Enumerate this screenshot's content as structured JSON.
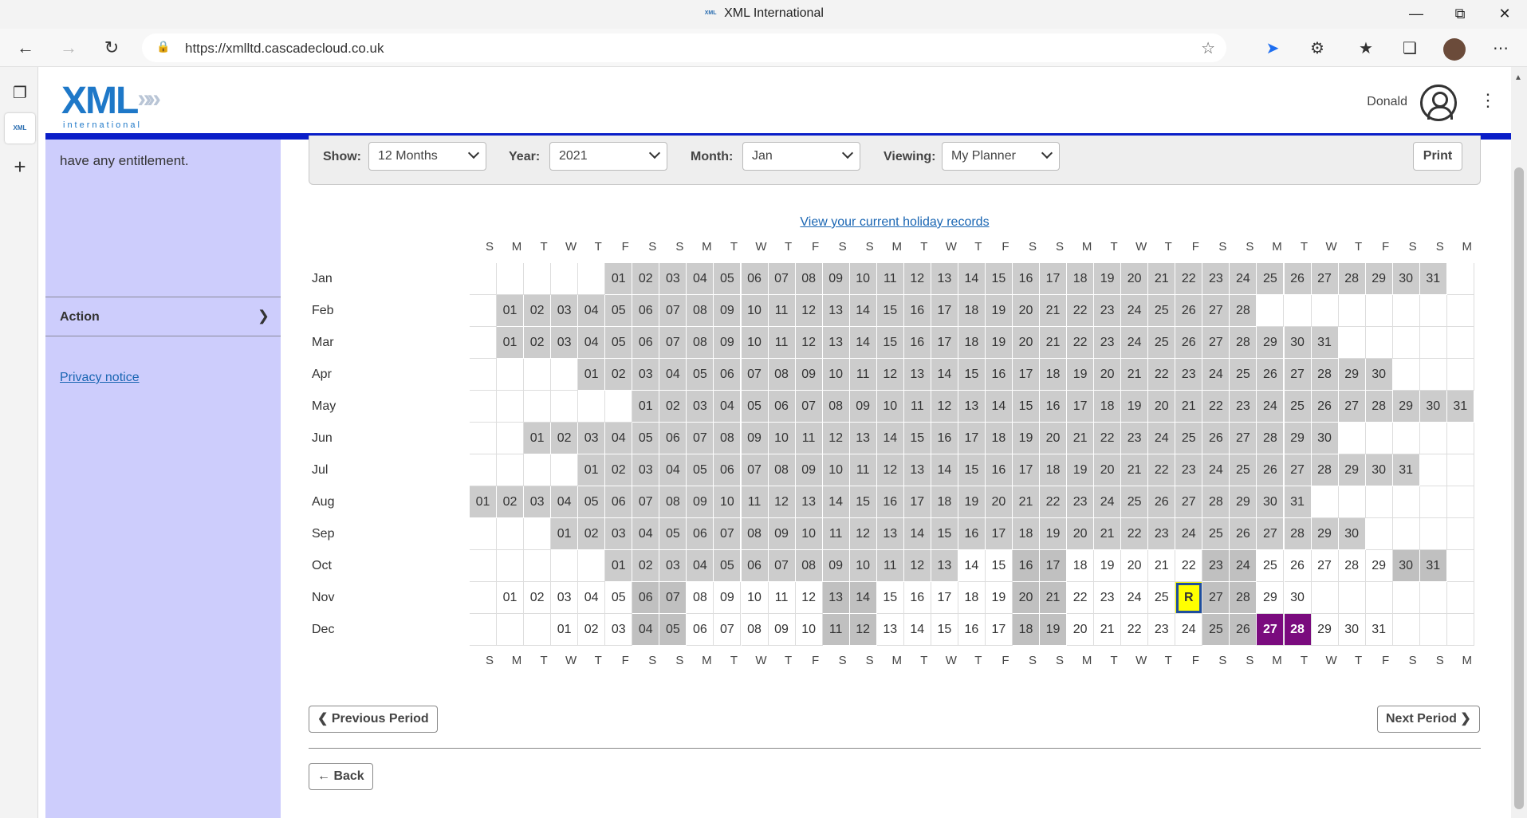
{
  "browser": {
    "title": "XML International",
    "url": "https://xmlltd.cascadecloud.co.uk",
    "favicon_text": "XML"
  },
  "header": {
    "logo_main": "XML",
    "logo_sub": "international",
    "username": "Donald"
  },
  "sidebar": {
    "entitlement_partial": "have any entitlement.",
    "action_label": "Action",
    "privacy_link": "Privacy notice"
  },
  "filters": {
    "show_label": "Show:",
    "show_value": "12 Months",
    "year_label": "Year:",
    "year_value": "2021",
    "month_label": "Month:",
    "month_value": "Jan",
    "viewing_label": "Viewing:",
    "viewing_value": "My Planner",
    "print_label": "Print"
  },
  "view_holiday_link": "View your current holiday records",
  "weekday_headers": [
    "S",
    "M",
    "T",
    "W",
    "T",
    "F",
    "S",
    "S",
    "M",
    "T",
    "W",
    "T",
    "F",
    "S",
    "S",
    "M",
    "T",
    "W",
    "T",
    "F",
    "S",
    "S",
    "M",
    "T",
    "W",
    "T",
    "F",
    "S",
    "S",
    "M",
    "T",
    "W",
    "T",
    "F",
    "S",
    "S",
    "M"
  ],
  "months": [
    {
      "name": "Jan",
      "offset": 5,
      "days": 31
    },
    {
      "name": "Feb",
      "offset": 1,
      "days": 28
    },
    {
      "name": "Mar",
      "offset": 1,
      "days": 31
    },
    {
      "name": "Apr",
      "offset": 4,
      "days": 30
    },
    {
      "name": "May",
      "offset": 6,
      "days": 31
    },
    {
      "name": "Jun",
      "offset": 2,
      "days": 30
    },
    {
      "name": "Jul",
      "offset": 4,
      "days": 31
    },
    {
      "name": "Aug",
      "offset": 0,
      "days": 31
    },
    {
      "name": "Sep",
      "offset": 3,
      "days": 30
    },
    {
      "name": "Oct",
      "offset": 5,
      "days": 31
    },
    {
      "name": "Nov",
      "offset": 1,
      "days": 30
    },
    {
      "name": "Dec",
      "offset": 3,
      "days": 31
    }
  ],
  "planner_state": {
    "past_until": {
      "month": 9,
      "day": 13
    },
    "requested": {
      "month": 10,
      "day": 26,
      "label": "R"
    },
    "booked": [
      {
        "month": 11,
        "day": 27
      },
      {
        "month": 11,
        "day": 28
      }
    ],
    "colors": {
      "past": "#cccccc",
      "weekend": "#c0c0c0",
      "requested": "#ffff00",
      "booked": "#7a0b7e"
    }
  },
  "buttons": {
    "previous_period": "Previous Period",
    "next_period": "Next Period",
    "back": "Back"
  }
}
